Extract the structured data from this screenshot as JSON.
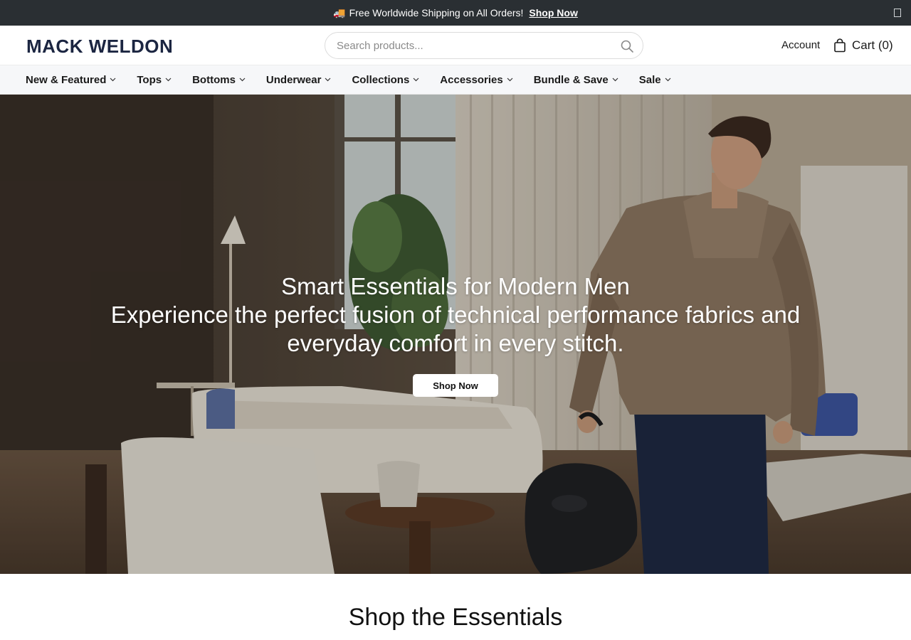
{
  "announcement": {
    "icon": "truck-icon",
    "text": "Free Worldwide Shipping on All Orders!",
    "link": "Shop Now"
  },
  "header": {
    "logo": "MACK WELDON",
    "search_placeholder": "Search products...",
    "account": "Account",
    "cart": "Cart (0)"
  },
  "nav": {
    "items": [
      {
        "label": "New & Featured"
      },
      {
        "label": "Tops"
      },
      {
        "label": "Bottoms"
      },
      {
        "label": "Underwear"
      },
      {
        "label": "Collections"
      },
      {
        "label": "Accessories"
      },
      {
        "label": "Bundle & Save"
      },
      {
        "label": "Sale"
      }
    ]
  },
  "hero": {
    "title": "Smart Essentials for Modern Men",
    "subtitle": "Experience the perfect fusion of technical performance fabrics and everyday comfort in every stitch.",
    "button": "Shop Now"
  },
  "section": {
    "title": "Shop the Essentials"
  },
  "colors": {
    "announcement_bg": "#2a2f33",
    "logo": "#1b2541",
    "nav_bg": "#f6f7f9"
  }
}
